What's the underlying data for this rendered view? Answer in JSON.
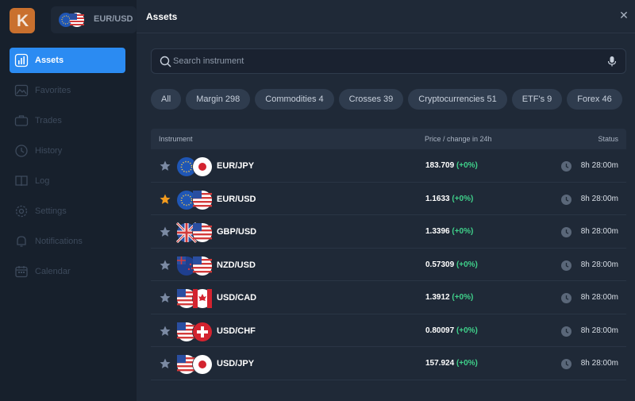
{
  "app": {
    "logo_letter": "K",
    "pair": "EUR/USD",
    "nav": [
      {
        "label": "Assets",
        "icon": "bar-chart-icon",
        "active": true
      },
      {
        "label": "Favorites",
        "icon": "picture-icon"
      },
      {
        "label": "Trades",
        "icon": "briefcase-icon"
      },
      {
        "label": "History",
        "icon": "clock-icon"
      },
      {
        "label": "Log",
        "icon": "book-icon"
      },
      {
        "label": "Settings",
        "icon": "gear-icon"
      },
      {
        "label": "Notifications",
        "icon": "bell-icon"
      },
      {
        "label": "Calendar",
        "icon": "calendar-icon"
      }
    ]
  },
  "panel": {
    "title": "Assets",
    "close_icon": "close-icon",
    "search": {
      "placeholder": "Search instrument",
      "icon": "search-icon",
      "mic_icon": "microphone-icon"
    },
    "filters": [
      {
        "label": "All"
      },
      {
        "label": "Margin 298"
      },
      {
        "label": "Commodities 4"
      },
      {
        "label": "Crosses 39"
      },
      {
        "label": "Cryptocurrencies 51"
      },
      {
        "label": "ETF's 9"
      },
      {
        "label": "Forex 46"
      }
    ],
    "table": {
      "headers": {
        "instrument": "Instrument",
        "price": "Price / change in 24h",
        "status": "Status"
      },
      "rows": [
        {
          "symbol": "EUR/JPY",
          "price": "183.709",
          "change": "(+0%)",
          "status": "8h 28:00m",
          "favorite": false,
          "flags": [
            "EU",
            "JP"
          ]
        },
        {
          "symbol": "EUR/USD",
          "price": "1.1633",
          "change": "(+0%)",
          "status": "8h 28:00m",
          "favorite": true,
          "flags": [
            "EU",
            "US"
          ]
        },
        {
          "symbol": "GBP/USD",
          "price": "1.3396",
          "change": "(+0%)",
          "status": "8h 28:00m",
          "favorite": false,
          "flags": [
            "GB",
            "US"
          ]
        },
        {
          "symbol": "NZD/USD",
          "price": "0.57309",
          "change": "(+0%)",
          "status": "8h 28:00m",
          "favorite": false,
          "flags": [
            "NZ",
            "US"
          ]
        },
        {
          "symbol": "USD/CAD",
          "price": "1.3912",
          "change": "(+0%)",
          "status": "8h 28:00m",
          "favorite": false,
          "flags": [
            "US",
            "CA"
          ]
        },
        {
          "symbol": "USD/CHF",
          "price": "0.80097",
          "change": "(+0%)",
          "status": "8h 28:00m",
          "favorite": false,
          "flags": [
            "US",
            "CH"
          ]
        },
        {
          "symbol": "USD/JPY",
          "price": "157.924",
          "change": "(+0%)",
          "status": "8h 28:00m",
          "favorite": false,
          "flags": [
            "US",
            "JP"
          ]
        }
      ]
    }
  },
  "colors": {
    "accent": "#2b8bf2",
    "positive": "#3fd08a",
    "favorite": "#f39b1e",
    "star_off": "#7b8aa3"
  }
}
